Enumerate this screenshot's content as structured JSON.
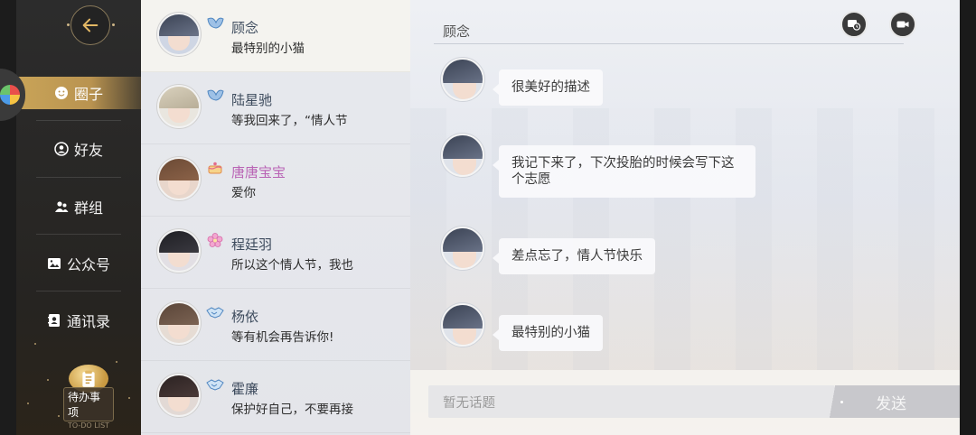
{
  "nav": {
    "items": [
      {
        "label": "圈子",
        "icon": "smile-face-icon",
        "active": true
      },
      {
        "label": "好友",
        "icon": "person-circle-icon",
        "active": false
      },
      {
        "label": "群组",
        "icon": "group-people-icon",
        "active": false
      },
      {
        "label": "公众号",
        "icon": "image-icon",
        "active": false
      },
      {
        "label": "通讯录",
        "icon": "address-book-icon",
        "active": false
      }
    ],
    "todo": {
      "label": "待办事项",
      "sub": "TO-DO LIST"
    }
  },
  "contacts": [
    {
      "name": "顾念",
      "message": "最特别的小猫",
      "badge": "wing-badge-icon",
      "name_color": "#3d4b5d",
      "selected": true
    },
    {
      "name": "陆星驰",
      "message": "等我回来了，“情人节",
      "badge": "wing-badge-icon",
      "name_color": "#3d4b5d",
      "selected": false
    },
    {
      "name": "唐唐宝宝",
      "message": "爱你",
      "badge": "cake-badge-icon",
      "name_color": "#b964b5",
      "selected": false
    },
    {
      "name": "程廷羽",
      "message": "所以这个情人节，我也",
      "badge": "flower-badge-icon",
      "name_color": "#3d4b5d",
      "selected": false
    },
    {
      "name": "杨依",
      "message": "等有机会再告诉你!",
      "badge": "handshake-badge-icon",
      "name_color": "#3d4b5d",
      "selected": false
    },
    {
      "name": "霍廉",
      "message": "保护好自己，不要再接",
      "badge": "handshake-badge-icon",
      "name_color": "#3d4b5d",
      "selected": false
    }
  ],
  "chat": {
    "title": "顾念",
    "messages": [
      {
        "text": "很美好的描述"
      },
      {
        "text": "我记下来了，下次投胎的时候会写下这个志愿"
      },
      {
        "text": "差点忘了，情人节快乐"
      },
      {
        "text": "最特别的小猫"
      }
    ],
    "input_placeholder": "暂无话题",
    "send_label": "发送"
  },
  "colors": {
    "accent_gold": "#c9a458",
    "nav_bg": "#2a2a2a",
    "name_default": "#3d4b5d",
    "name_special": "#b964b5"
  }
}
